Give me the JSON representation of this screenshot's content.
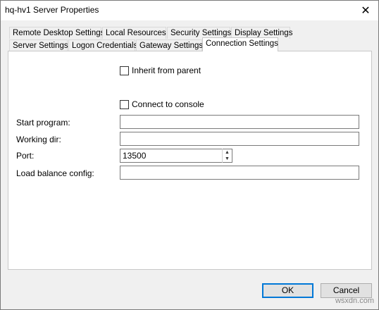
{
  "window": {
    "title": "hq-hv1 Server Properties",
    "close_glyph": "✕"
  },
  "tabs_row1": [
    {
      "label": "Remote Desktop Settings"
    },
    {
      "label": "Local Resources"
    },
    {
      "label": "Security Settings"
    },
    {
      "label": "Display Settings"
    }
  ],
  "tabs_row2": [
    {
      "label": "Server Settings"
    },
    {
      "label": "Logon Credentials"
    },
    {
      "label": "Gateway Settings"
    },
    {
      "label": "Connection Settings",
      "active": true
    }
  ],
  "form": {
    "inherit_label": "Inherit from parent",
    "inherit_checked": false,
    "console_label": "Connect to console",
    "console_checked": false,
    "start_program_label": "Start program:",
    "start_program_value": "",
    "working_dir_label": "Working dir:",
    "working_dir_value": "",
    "port_label": "Port:",
    "port_value": "13500",
    "load_balance_label": "Load balance config:",
    "load_balance_value": ""
  },
  "buttons": {
    "ok": "OK",
    "cancel": "Cancel"
  },
  "watermark": "wsxdn.com"
}
